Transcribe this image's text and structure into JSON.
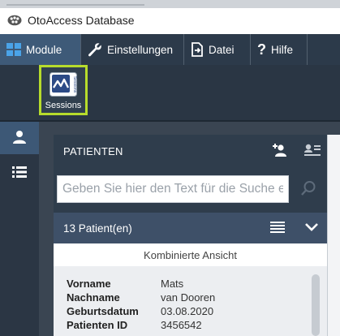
{
  "app": {
    "title": "OtoAccess Database",
    "icon": "oto-logo-icon"
  },
  "menubar": {
    "items": [
      {
        "label": "Module",
        "icon": "grid-icon"
      },
      {
        "label": "Einstellungen",
        "icon": "wrench-icon"
      },
      {
        "label": "Datei",
        "icon": "file-export-icon"
      },
      {
        "label": "Hilfe",
        "icon": "question-icon"
      }
    ]
  },
  "ribbon": {
    "sessions_label": "Sessions",
    "sessions_tile_text": "Sessions"
  },
  "patients": {
    "title": "PATIENTEN",
    "search_placeholder": "Geben Sie hier den Text für die Suche ein",
    "count_label": "13 Patient(en)",
    "view_label": "Kombinierte Ansicht",
    "selected": {
      "first_name_label": "Vorname",
      "first_name": "Mats",
      "last_name_label": "Nachname",
      "last_name": "van Dooren",
      "birth_label": "Geburtsdatum",
      "birth": "03.08.2020",
      "id_label": "Patienten ID",
      "id": "3456542"
    }
  },
  "colors": {
    "accent_highlight": "#b7dc2c",
    "menubar": "#2c3a4a",
    "active_menu": "#3e5a78"
  }
}
